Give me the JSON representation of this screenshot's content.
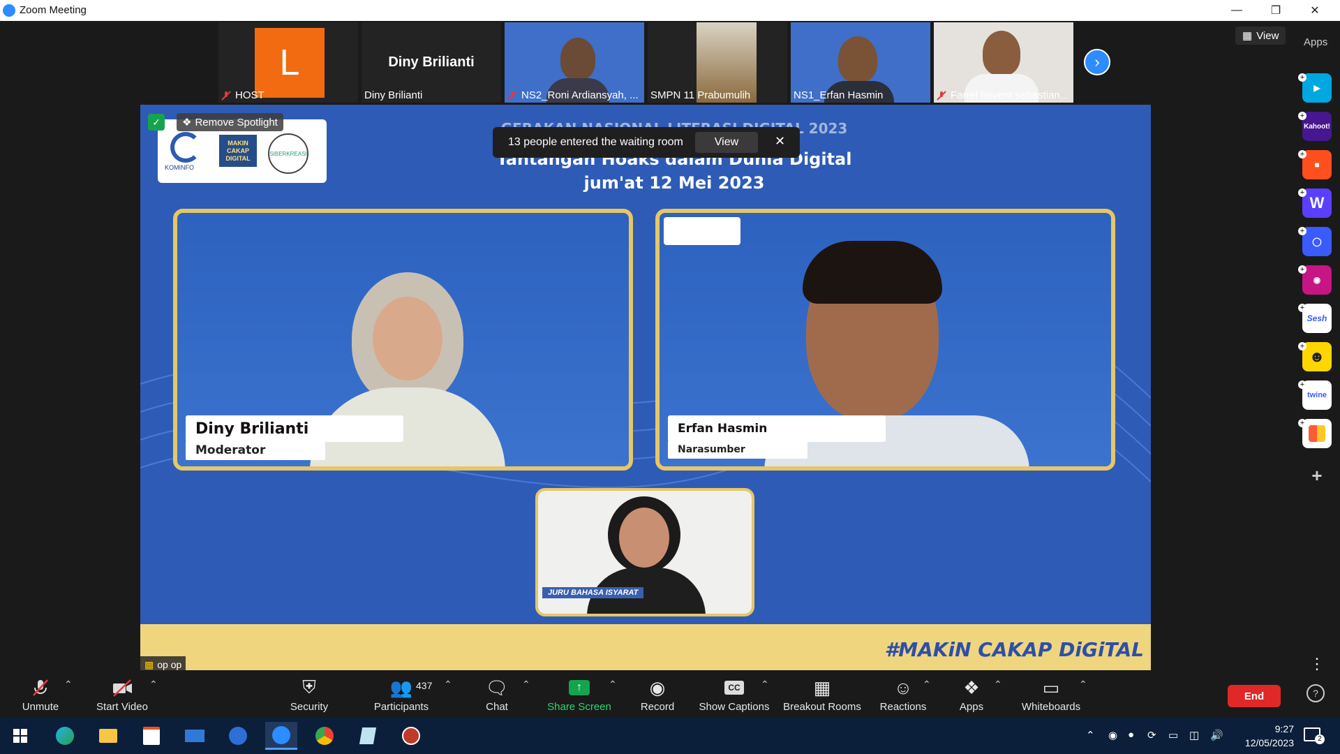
{
  "window": {
    "title": "Zoom Meeting"
  },
  "gallery": {
    "tiles": [
      {
        "avatar_letter": "L",
        "name": "HOST"
      },
      {
        "display_name": "Diny Brilianti",
        "name": "Diny Brilianti"
      },
      {
        "name": "NS2_Roni Ardiansyah, ..."
      },
      {
        "name": "SMPN 11 Prabumulih"
      },
      {
        "name": "NS1_Erfan Hasmin"
      },
      {
        "name": "Farrel hevent sebastian..."
      }
    ],
    "view_label": "View",
    "apps_label": "Apps"
  },
  "spotlight": {
    "remove_label": "Remove Spotlight"
  },
  "notification": {
    "message": "13 people entered the waiting room",
    "view_label": "View"
  },
  "slide": {
    "heading": "GERAKAN NASIONAL LITERASI DIGITAL 2023",
    "title": "Tantangan Hoaks dalam Dunia Digital",
    "date": "jum'at 12 Mei 2023",
    "logos": [
      "KOMINFO",
      "MAKIN CAKAP DIGITAL",
      "SIBERKREASI"
    ],
    "speaker1": {
      "name": "Diny Brilianti",
      "role": "Moderator"
    },
    "speaker2": {
      "name": "Erfan Hasmin",
      "role": "Narasumber"
    },
    "interpreter_label": "JURU BAHASA ISYARAT",
    "hashtag": "#MAKiN CAKAP DiGiTAL"
  },
  "connection": {
    "label": "op op"
  },
  "toolbar": {
    "unmute": "Unmute",
    "start_video": "Start Video",
    "security": "Security",
    "participants": "Participants",
    "participants_count": "437",
    "chat": "Chat",
    "share_screen": "Share Screen",
    "record": "Record",
    "show_captions": "Show Captions",
    "breakout_rooms": "Breakout Rooms",
    "reactions": "Reactions",
    "apps": "Apps",
    "whiteboards": "Whiteboards",
    "end": "End"
  },
  "sidebar_apps": [
    "Pitch",
    "Kahoot!",
    "Taskade",
    "Wooclap",
    "Reclaim AI",
    "Hoot",
    "Sesh",
    "Emoji",
    "twine",
    "Mural"
  ],
  "taskbar": {
    "time": "9:27",
    "date": "12/05/2023",
    "notifications": "2"
  },
  "colors": {
    "zoom_blue": "#2d8cff",
    "slide_blue": "#2e5bb5",
    "frame_gold": "#e6c766",
    "end_red": "#e02828",
    "share_green": "#14a44d"
  }
}
